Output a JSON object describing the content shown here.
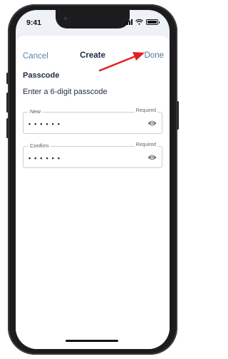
{
  "status_bar": {
    "time": "9:41",
    "icons": [
      "cellular-signal-icon",
      "wifi-icon",
      "battery-icon"
    ]
  },
  "nav": {
    "cancel_label": "Cancel",
    "title": "Create",
    "done_label": "Done"
  },
  "passcode": {
    "section_title": "Passcode",
    "instruction": "Enter a 6-digit passcode",
    "fields": [
      {
        "label": "New",
        "required_text": "Required",
        "value": "••••••",
        "icon": "eye-icon"
      },
      {
        "label": "Confirm",
        "required_text": "Required",
        "value": "••••••",
        "icon": "eye-icon"
      }
    ]
  },
  "annotation": {
    "arrow_color": "#e01f26",
    "points_to": "done-button"
  },
  "colors": {
    "link": "#5d86a6",
    "heading": "#1e2a44",
    "field_border": "#c9ced6",
    "phone_frame": "#1c1c1e"
  }
}
